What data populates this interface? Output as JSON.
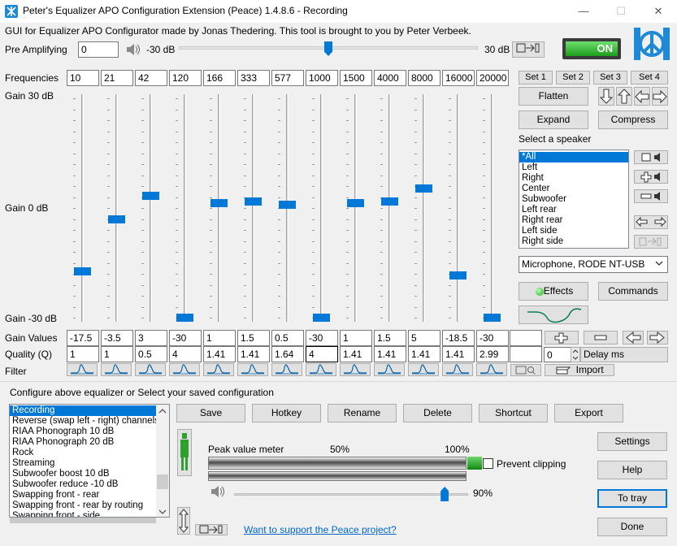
{
  "window": {
    "title": "Peter's Equalizer APO Configuration Extension (Peace) 1.4.8.6 - Recording",
    "minimize": "—",
    "maximize": "☐",
    "close": "✕"
  },
  "credit": "GUI for Equalizer APO Configurator made by Jonas Thedering. This tool is brought to you by Peter Verbeek.",
  "preamp": {
    "label": "Pre Amplifying",
    "value": "0",
    "min_label": "-30 dB",
    "max_label": "30 dB",
    "level_db": 0
  },
  "power_label": "ON",
  "frequencies_label": "Frequencies",
  "frequencies": [
    "10",
    "21",
    "42",
    "120",
    "166",
    "333",
    "577",
    "1000",
    "1500",
    "4000",
    "8000",
    "16000",
    "20000"
  ],
  "gain_axis": {
    "top": "Gain 30 dB",
    "mid": "Gain 0 dB",
    "bottom": "Gain -30 dB"
  },
  "gain_values_label": "Gain Values",
  "gain_values": [
    "-17.5",
    "-3.5",
    "3",
    "-30",
    "1",
    "1.5",
    "0.5",
    "-30",
    "1",
    "1.5",
    "5",
    "-18.5",
    "-30"
  ],
  "quality_label": "Quality (Q)",
  "quality_values": [
    "1",
    "1",
    "0.5",
    "4",
    "1.41",
    "1.41",
    "1.64",
    "4",
    "1.41",
    "1.41",
    "1.41",
    "1.41",
    "2.99"
  ],
  "filter_label": "Filter",
  "sets": [
    "Set 1",
    "Set 2",
    "Set 3",
    "Set 4"
  ],
  "buttons": {
    "flatten": "Flatten",
    "expand": "Expand",
    "compress": "Compress",
    "effects": "Effects",
    "commands": "Commands",
    "import": "Import",
    "save": "Save",
    "hotkey": "Hotkey",
    "rename": "Rename",
    "delete": "Delete",
    "shortcut": "Shortcut",
    "export": "Export",
    "settings": "Settings",
    "help": "Help",
    "to_tray": "To tray",
    "done": "Done"
  },
  "speaker": {
    "label": "Select a speaker",
    "items": [
      "*All",
      "Left",
      "Right",
      "Center",
      "Subwoofer",
      "Left rear",
      "Right rear",
      "Left side",
      "Right side"
    ],
    "selected": 0
  },
  "device": "Microphone, RODE NT-USB",
  "delay": {
    "value": "0",
    "label": "Delay ms"
  },
  "config": {
    "label": "Configure above equalizer or Select your saved configuration",
    "items": [
      "Recording",
      "Reverse (swap left - right) channels",
      "RIAA Phonograph 10 dB",
      "RIAA Phonograph 20 dB",
      "Rock",
      "Streaming",
      "Subwoofer boost 10 dB",
      "Subwoofer reduce -10 dB",
      "Swapping front - rear",
      "Swapping front - rear by routing",
      "Swapping front - side"
    ],
    "selected": 0
  },
  "meter": {
    "label": "Peak value meter",
    "mark_50": "50%",
    "mark_100": "100%",
    "prevent_clipping": "Prevent clipping",
    "volume_label": "90%",
    "volume": 0.9
  },
  "support_link": "Want to support the Peace project?"
}
